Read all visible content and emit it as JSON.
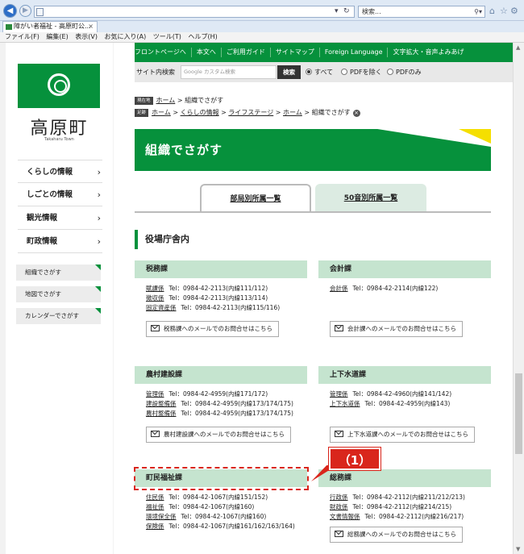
{
  "browser": {
    "search_placeholder": "検索...",
    "tab_title": "障がい者福祉 - 高原町公...",
    "tab_close": "×",
    "menu": [
      "ファイル(F)",
      "編集(E)",
      "表示(V)",
      "お気に入り(A)",
      "ツール(T)",
      "ヘルプ(H)"
    ]
  },
  "sidebar": {
    "town_name": "高原町",
    "town_en": "Takaharu Town",
    "nav": [
      {
        "label": "くらしの情報"
      },
      {
        "label": "しごとの情報"
      },
      {
        "label": "観光情報"
      },
      {
        "label": "町政情報"
      }
    ],
    "buttons": [
      {
        "label": "組織でさがす"
      },
      {
        "label": "地図でさがす"
      },
      {
        "label": "カレンダーでさがす"
      }
    ]
  },
  "topnav": [
    "フロントページへ",
    "本文へ",
    "ご利用ガイド",
    "サイトマップ",
    "Foreign Language",
    "文字拡大・音声よみあげ"
  ],
  "search": {
    "label": "サイト内検索",
    "placeholder": "Google カスタム検索",
    "button": "検索",
    "options": [
      "すべて",
      "PDFを除く",
      "PDFのみ"
    ]
  },
  "breadcrumb": {
    "current_badge": "現在地",
    "current": [
      "ホーム",
      "組織でさがす"
    ],
    "history_badge": "足跡",
    "history": [
      "ホーム",
      "くらしの情報",
      "ライフステージ",
      "ホーム",
      "組織でさがす"
    ]
  },
  "page_title": "組織でさがす",
  "tabs": [
    "部局別所属一覧",
    "50音別所属一覧"
  ],
  "section_title": "役場庁舎内",
  "departments": [
    {
      "name": "税務課",
      "rows": [
        {
          "name": "賦課係",
          "tel": "Tel：0984-42-2113(内線111/112)"
        },
        {
          "name": "徴収係",
          "tel": "Tel：0984-42-2113(内線113/114)"
        },
        {
          "name": "固定資産係",
          "tel": "Tel：0984-42-2113(内線115/116)"
        }
      ],
      "mail": "税務課へのメールでのお問合せはこちら"
    },
    {
      "name": "会計課",
      "rows": [
        {
          "name": "会計係",
          "tel": "Tel：0984-42-2114(内線122)"
        }
      ],
      "mail": "会計課へのメールでのお問合せはこちら"
    },
    {
      "name": "農村建設課",
      "rows": [
        {
          "name": "管理係",
          "tel": "Tel：0984-42-4959(内線171/172)"
        },
        {
          "name": "建設整備係",
          "tel": "Tel：0984-42-4959(内線173/174/175)"
        },
        {
          "name": "農村整備係",
          "tel": "Tel：0984-42-4959(内線173/174/175)"
        }
      ],
      "mail": "農村建設課へのメールでのお問合せはこちら"
    },
    {
      "name": "上下水道課",
      "rows": [
        {
          "name": "管理係",
          "tel": "Tel：0984-42-4960(内線141/142)"
        },
        {
          "name": "上下水道係",
          "tel": "Tel：0984-42-4959(内線143)"
        }
      ],
      "mail": "上下水道課へのメールでのお問合せはこちら"
    },
    {
      "name": "町民福祉課",
      "rows": [
        {
          "name": "住民係",
          "tel": "Tel：0984-42-1067(内線151/152)"
        },
        {
          "name": "福祉係",
          "tel": "Tel：0984-42-1067(内線160)"
        },
        {
          "name": "環境保全係",
          "tel": "Tel：0984-42-1067(内線160)"
        },
        {
          "name": "保険係",
          "tel": "Tel：0984-42-1067(内線161/162/163/164)"
        }
      ],
      "mail": ""
    },
    {
      "name": "総務課",
      "rows": [
        {
          "name": "行政係",
          "tel": "Tel：0984-42-2112(内線211/212/213)"
        },
        {
          "name": "財政係",
          "tel": "Tel：0984-42-2112(内線214/215)"
        },
        {
          "name": "文書情報係",
          "tel": "Tel：0984-42-2112(内線216/217)"
        }
      ],
      "mail": "総務課へのメールでのお問合せはこちら"
    }
  ],
  "annotation": {
    "label": "（1）"
  },
  "colors": {
    "brand_green": "#06913c",
    "header_tint": "#c5e4cf",
    "annotation_red": "#d9261c"
  }
}
